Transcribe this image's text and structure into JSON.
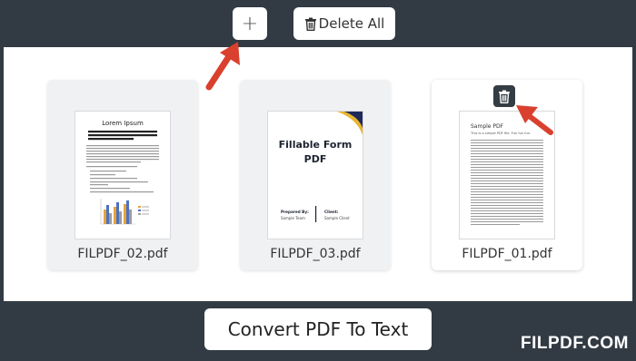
{
  "toolbar": {
    "add_icon": "plus-icon",
    "add_label": "+",
    "delete_all_icon": "trash-icon",
    "delete_all_label": "Delete All"
  },
  "files": [
    {
      "name": "FILPDF_02.pdf",
      "thumb_title": "Lorem Ipsum",
      "thumb_subtitle": "Lorem ipsum dolor sit amet, consectetur adipiscing elit, nunc ac facilisis odio."
    },
    {
      "name": "FILPDF_03.pdf",
      "thumb_title": "Fillable Form PDF",
      "thumb_prepared_label": "Prepared By:",
      "thumb_prepared_value": "Sample Team",
      "thumb_client_label": "Client:",
      "thumb_client_value": "Sample Client"
    },
    {
      "name": "FILPDF_01.pdf",
      "thumb_title": "Sample PDF",
      "thumb_subtitle": "This is a simple PDF file. Fun fun fun."
    }
  ],
  "actions": {
    "convert_label": "Convert PDF To Text"
  },
  "brand": {
    "name": "FILPDF.COM"
  },
  "colors": {
    "frame_bg": "#323b44",
    "panel_bg": "#ffffff",
    "arrow_red": "#d9402e"
  }
}
